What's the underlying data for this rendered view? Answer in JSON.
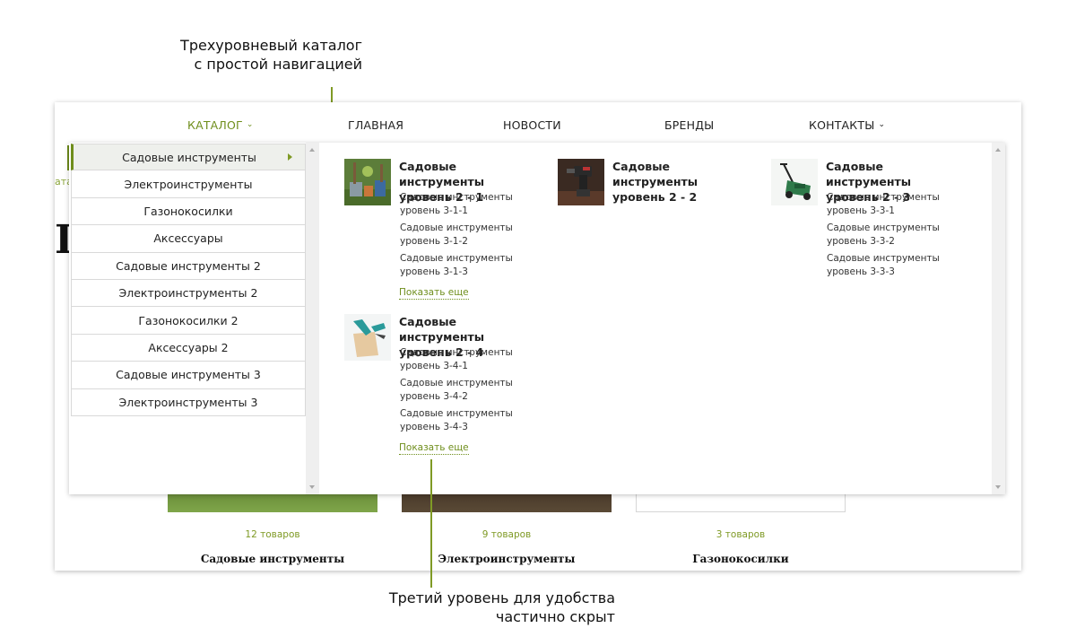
{
  "callouts": {
    "top_line1": "Трехуровневый каталог",
    "top_line2": "с простой навигацией",
    "bottom_line1": "Третий уровень для удобства",
    "bottom_line2": "частично скрыт"
  },
  "nav": {
    "catalog": "КАТАЛОГ",
    "home": "ГЛАВНАЯ",
    "news": "НОВОСТИ",
    "brands": "БРЕНДЫ",
    "contacts": "КОНТАКТЫ"
  },
  "background": {
    "breadcrumb": "ата",
    "heading": "I",
    "cards": [
      {
        "count": "12 товаров",
        "title": "Садовые инструменты"
      },
      {
        "count": "9 товаров",
        "title": "Электроинструменты"
      },
      {
        "count": "3 товаров",
        "title": "Газонокосилки"
      }
    ]
  },
  "level1": [
    {
      "label": "Садовые инструменты",
      "active": true
    },
    {
      "label": "Электроинструменты"
    },
    {
      "label": "Газонокосилки"
    },
    {
      "label": "Аксессуары"
    },
    {
      "label": "Садовые инструменты 2"
    },
    {
      "label": "Электроинструменты 2"
    },
    {
      "label": "Газонокосилки 2"
    },
    {
      "label": "Аксессуары 2"
    },
    {
      "label": "Садовые инструменты 3"
    },
    {
      "label": "Электроинструменты 3"
    }
  ],
  "groups": [
    {
      "title_line1": "Садовые инструменты",
      "title_line2": "уровень 2 - 1",
      "image": "garden-tools-image",
      "subs": [
        {
          "l1": "Садовые инструменты",
          "l2": "уровень 3-1-1"
        },
        {
          "l1": "Садовые инструменты",
          "l2": "уровень 3-1-2"
        },
        {
          "l1": "Садовые инструменты",
          "l2": "уровень 3-1-3"
        }
      ],
      "more": "Показать еще"
    },
    {
      "title_line1": "Садовые инструменты",
      "title_line2": "уровень 2 - 2",
      "image": "power-drill-image",
      "subs": []
    },
    {
      "title_line1": "Садовые инструменты",
      "title_line2": "уровень 2 - 3",
      "image": "lawn-mower-image",
      "subs": [
        {
          "l1": "Садовые инструменты",
          "l2": "уровень 3-3-1"
        },
        {
          "l1": "Садовые инструменты",
          "l2": "уровень 3-3-2"
        },
        {
          "l1": "Садовые инструменты",
          "l2": "уровень 3-3-3"
        }
      ]
    },
    {
      "title_line1": "Садовые инструменты",
      "title_line2": "уровень 2 - 4",
      "image": "pruner-tool-image",
      "subs": [
        {
          "l1": "Садовые инструменты",
          "l2": "уровень 3-4-1"
        },
        {
          "l1": "Садовые инструменты",
          "l2": "уровень 3-4-2"
        },
        {
          "l1": "Садовые инструменты",
          "l2": "уровень 3-4-3"
        }
      ],
      "more": "Показать еще"
    }
  ],
  "colors": {
    "accent": "#6f8e1c",
    "callout_line": "#7f9a25"
  }
}
